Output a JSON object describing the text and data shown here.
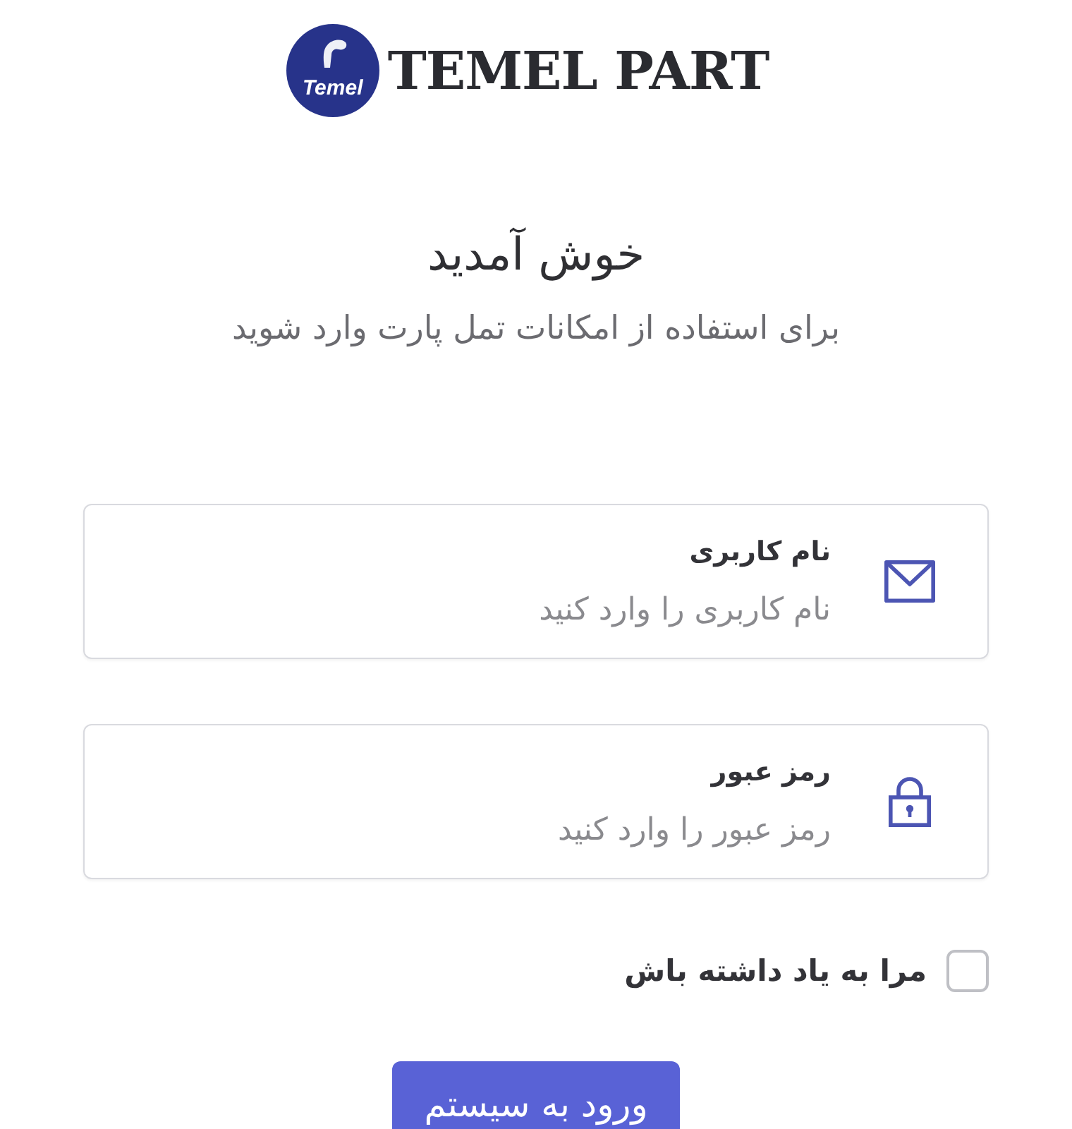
{
  "logo": {
    "badge_text": "Temel",
    "wordmark": "TEMEL PART"
  },
  "heading": {
    "title": "خوش آمدید",
    "subtitle": "برای استفاده از امکانات تمل پارت وارد شوید"
  },
  "fields": [
    {
      "kind": "email",
      "label": "نام کاربری",
      "placeholder": "نام کاربری را وارد کنید"
    },
    {
      "kind": "password",
      "label": "رمز عبور",
      "placeholder": "رمز عبور را وارد کنید"
    }
  ],
  "remember": {
    "label": "مرا به یاد داشته باش",
    "checked": false
  },
  "submit_button": "ورود به سیستم"
}
